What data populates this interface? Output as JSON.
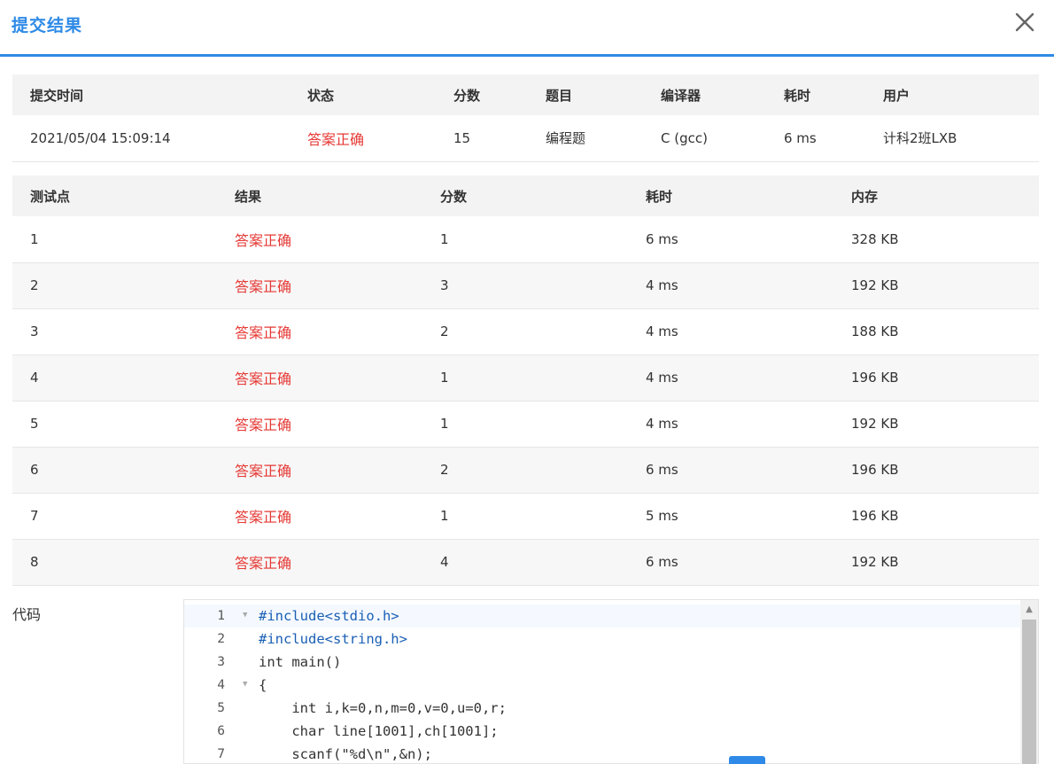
{
  "header": {
    "title": "提交结果",
    "close_icon": "close-icon"
  },
  "summary": {
    "columns": [
      "提交时间",
      "状态",
      "分数",
      "题目",
      "编译器",
      "耗时",
      "用户"
    ],
    "row": {
      "time": "2021/05/04 15:09:14",
      "status": "答案正确",
      "score": "15",
      "problem": "编程题",
      "compiler": "C (gcc)",
      "duration": "6 ms",
      "user": "计科2班LXB"
    }
  },
  "tests": {
    "columns": [
      "测试点",
      "结果",
      "分数",
      "耗时",
      "内存"
    ],
    "rows": [
      {
        "id": "1",
        "result": "答案正确",
        "score": "1",
        "time": "6 ms",
        "memory": "328 KB"
      },
      {
        "id": "2",
        "result": "答案正确",
        "score": "3",
        "time": "4 ms",
        "memory": "192 KB"
      },
      {
        "id": "3",
        "result": "答案正确",
        "score": "2",
        "time": "4 ms",
        "memory": "188 KB"
      },
      {
        "id": "4",
        "result": "答案正确",
        "score": "1",
        "time": "4 ms",
        "memory": "196 KB"
      },
      {
        "id": "5",
        "result": "答案正确",
        "score": "1",
        "time": "4 ms",
        "memory": "192 KB"
      },
      {
        "id": "6",
        "result": "答案正确",
        "score": "2",
        "time": "6 ms",
        "memory": "196 KB"
      },
      {
        "id": "7",
        "result": "答案正确",
        "score": "1",
        "time": "5 ms",
        "memory": "196 KB"
      },
      {
        "id": "8",
        "result": "答案正确",
        "score": "4",
        "time": "6 ms",
        "memory": "192 KB"
      }
    ]
  },
  "code": {
    "label": "代码",
    "line_numbers": [
      "1",
      "2",
      "3",
      "4",
      "5",
      "6",
      "7"
    ],
    "lines": [
      "#include<stdio.h>",
      "#include<string.h>",
      "int main()",
      "{",
      "    int i,k=0,n,m=0,v=0,u=0,r;",
      "    char line[1001],ch[1001];",
      "    scanf(\"%d\\n\",&n);"
    ]
  },
  "colors": {
    "accent": "#2e8ae6",
    "accepted": "#e53935"
  }
}
